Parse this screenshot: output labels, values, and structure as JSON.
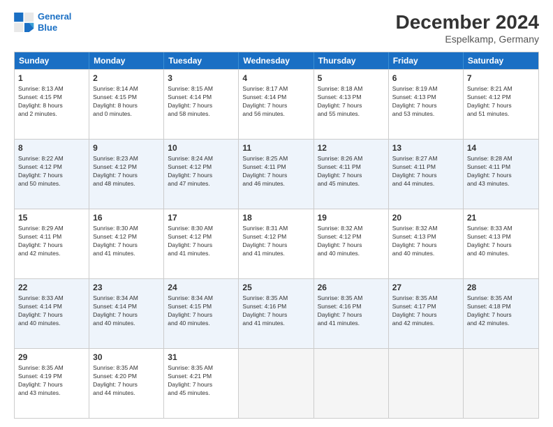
{
  "logo": {
    "line1": "General",
    "line2": "Blue"
  },
  "title": "December 2024",
  "location": "Espelkamp, Germany",
  "days_of_week": [
    "Sunday",
    "Monday",
    "Tuesday",
    "Wednesday",
    "Thursday",
    "Friday",
    "Saturday"
  ],
  "rows": [
    {
      "alt": false,
      "cells": [
        {
          "day": "1",
          "info": "Sunrise: 8:13 AM\nSunset: 4:15 PM\nDaylight: 8 hours\nand 2 minutes."
        },
        {
          "day": "2",
          "info": "Sunrise: 8:14 AM\nSunset: 4:15 PM\nDaylight: 8 hours\nand 0 minutes."
        },
        {
          "day": "3",
          "info": "Sunrise: 8:15 AM\nSunset: 4:14 PM\nDaylight: 7 hours\nand 58 minutes."
        },
        {
          "day": "4",
          "info": "Sunrise: 8:17 AM\nSunset: 4:14 PM\nDaylight: 7 hours\nand 56 minutes."
        },
        {
          "day": "5",
          "info": "Sunrise: 8:18 AM\nSunset: 4:13 PM\nDaylight: 7 hours\nand 55 minutes."
        },
        {
          "day": "6",
          "info": "Sunrise: 8:19 AM\nSunset: 4:13 PM\nDaylight: 7 hours\nand 53 minutes."
        },
        {
          "day": "7",
          "info": "Sunrise: 8:21 AM\nSunset: 4:12 PM\nDaylight: 7 hours\nand 51 minutes."
        }
      ]
    },
    {
      "alt": true,
      "cells": [
        {
          "day": "8",
          "info": "Sunrise: 8:22 AM\nSunset: 4:12 PM\nDaylight: 7 hours\nand 50 minutes."
        },
        {
          "day": "9",
          "info": "Sunrise: 8:23 AM\nSunset: 4:12 PM\nDaylight: 7 hours\nand 48 minutes."
        },
        {
          "day": "10",
          "info": "Sunrise: 8:24 AM\nSunset: 4:12 PM\nDaylight: 7 hours\nand 47 minutes."
        },
        {
          "day": "11",
          "info": "Sunrise: 8:25 AM\nSunset: 4:11 PM\nDaylight: 7 hours\nand 46 minutes."
        },
        {
          "day": "12",
          "info": "Sunrise: 8:26 AM\nSunset: 4:11 PM\nDaylight: 7 hours\nand 45 minutes."
        },
        {
          "day": "13",
          "info": "Sunrise: 8:27 AM\nSunset: 4:11 PM\nDaylight: 7 hours\nand 44 minutes."
        },
        {
          "day": "14",
          "info": "Sunrise: 8:28 AM\nSunset: 4:11 PM\nDaylight: 7 hours\nand 43 minutes."
        }
      ]
    },
    {
      "alt": false,
      "cells": [
        {
          "day": "15",
          "info": "Sunrise: 8:29 AM\nSunset: 4:11 PM\nDaylight: 7 hours\nand 42 minutes."
        },
        {
          "day": "16",
          "info": "Sunrise: 8:30 AM\nSunset: 4:12 PM\nDaylight: 7 hours\nand 41 minutes."
        },
        {
          "day": "17",
          "info": "Sunrise: 8:30 AM\nSunset: 4:12 PM\nDaylight: 7 hours\nand 41 minutes."
        },
        {
          "day": "18",
          "info": "Sunrise: 8:31 AM\nSunset: 4:12 PM\nDaylight: 7 hours\nand 41 minutes."
        },
        {
          "day": "19",
          "info": "Sunrise: 8:32 AM\nSunset: 4:12 PM\nDaylight: 7 hours\nand 40 minutes."
        },
        {
          "day": "20",
          "info": "Sunrise: 8:32 AM\nSunset: 4:13 PM\nDaylight: 7 hours\nand 40 minutes."
        },
        {
          "day": "21",
          "info": "Sunrise: 8:33 AM\nSunset: 4:13 PM\nDaylight: 7 hours\nand 40 minutes."
        }
      ]
    },
    {
      "alt": true,
      "cells": [
        {
          "day": "22",
          "info": "Sunrise: 8:33 AM\nSunset: 4:14 PM\nDaylight: 7 hours\nand 40 minutes."
        },
        {
          "day": "23",
          "info": "Sunrise: 8:34 AM\nSunset: 4:14 PM\nDaylight: 7 hours\nand 40 minutes."
        },
        {
          "day": "24",
          "info": "Sunrise: 8:34 AM\nSunset: 4:15 PM\nDaylight: 7 hours\nand 40 minutes."
        },
        {
          "day": "25",
          "info": "Sunrise: 8:35 AM\nSunset: 4:16 PM\nDaylight: 7 hours\nand 41 minutes."
        },
        {
          "day": "26",
          "info": "Sunrise: 8:35 AM\nSunset: 4:16 PM\nDaylight: 7 hours\nand 41 minutes."
        },
        {
          "day": "27",
          "info": "Sunrise: 8:35 AM\nSunset: 4:17 PM\nDaylight: 7 hours\nand 42 minutes."
        },
        {
          "day": "28",
          "info": "Sunrise: 8:35 AM\nSunset: 4:18 PM\nDaylight: 7 hours\nand 42 minutes."
        }
      ]
    },
    {
      "alt": false,
      "cells": [
        {
          "day": "29",
          "info": "Sunrise: 8:35 AM\nSunset: 4:19 PM\nDaylight: 7 hours\nand 43 minutes."
        },
        {
          "day": "30",
          "info": "Sunrise: 8:35 AM\nSunset: 4:20 PM\nDaylight: 7 hours\nand 44 minutes."
        },
        {
          "day": "31",
          "info": "Sunrise: 8:35 AM\nSunset: 4:21 PM\nDaylight: 7 hours\nand 45 minutes."
        },
        {
          "day": "",
          "info": ""
        },
        {
          "day": "",
          "info": ""
        },
        {
          "day": "",
          "info": ""
        },
        {
          "day": "",
          "info": ""
        }
      ]
    }
  ]
}
